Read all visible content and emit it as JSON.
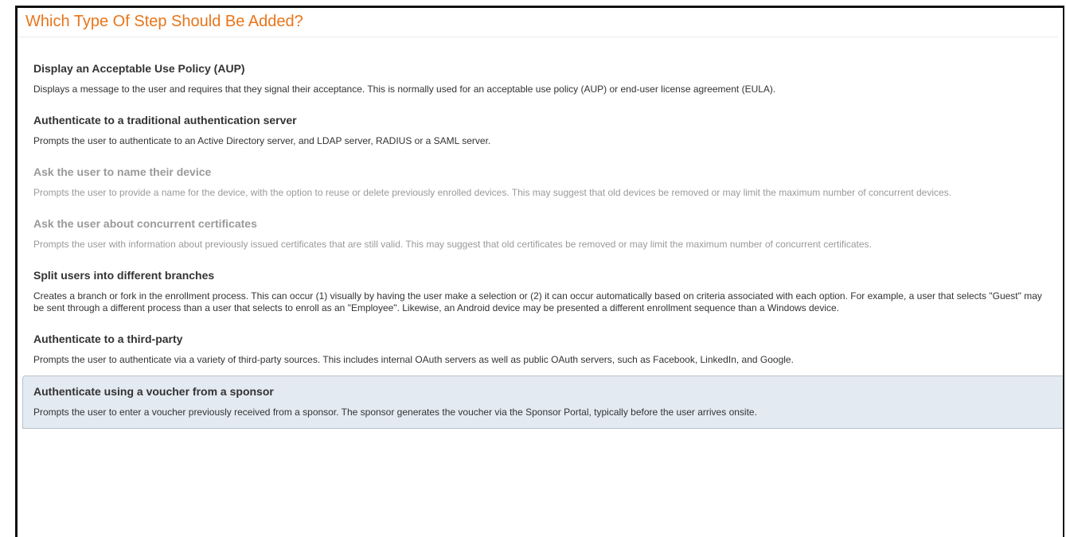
{
  "header": {
    "title": "Which Type Of Step Should Be Added?"
  },
  "steps": [
    {
      "label": "Display an Acceptable Use Policy (AUP)",
      "description": "Displays a message to the user and requires that they signal their acceptance. This is normally used for an acceptable use policy (AUP) or end-user license agreement (EULA).",
      "enabled": true
    },
    {
      "label": "Authenticate to a traditional authentication server",
      "description": "Prompts the user to authenticate to an Active Directory server, and LDAP server, RADIUS or a SAML server.",
      "enabled": true
    },
    {
      "label": "Ask the user to name their device",
      "description": "Prompts the user to provide a name for the device, with the option to reuse or delete previously enrolled devices. This may suggest that old devices be removed or may limit the maximum number of concurrent devices.",
      "enabled": false
    },
    {
      "label": "Ask the user about concurrent certificates",
      "description": "Prompts the user with information about previously issued certificates that are still valid. This may suggest that old certificates be removed or may limit the maximum number of concurrent certificates.",
      "enabled": false
    },
    {
      "label": "Split users into different branches",
      "description": "Creates a branch or fork in the enrollment process. This can occur (1) visually by having the user make a selection or (2) it can occur automatically based on criteria associated with each option. For example, a user that selects \"Guest\" may be sent through a different process than a user that selects to enroll as an \"Employee\". Likewise, an Android device may be presented a different enrollment sequence than a Windows device.",
      "enabled": true
    },
    {
      "label": "Authenticate to a third-party",
      "description": "Prompts the user to authenticate via a variety of third-party sources. This includes internal OAuth servers as well as public OAuth servers, such as Facebook, LinkedIn, and Google.",
      "enabled": true
    },
    {
      "label": "Authenticate using a voucher from a sponsor",
      "description": "Prompts the user to enter a voucher previously received from a sponsor. The sponsor generates the voucher via the Sponsor Portal, typically before the user arrives onsite.",
      "enabled": true,
      "selected": true
    }
  ],
  "colors": {
    "title": "#e8751a",
    "text": "#333333",
    "disabled_text": "#9a9a9a",
    "selected_background": "#e4eaf1"
  }
}
